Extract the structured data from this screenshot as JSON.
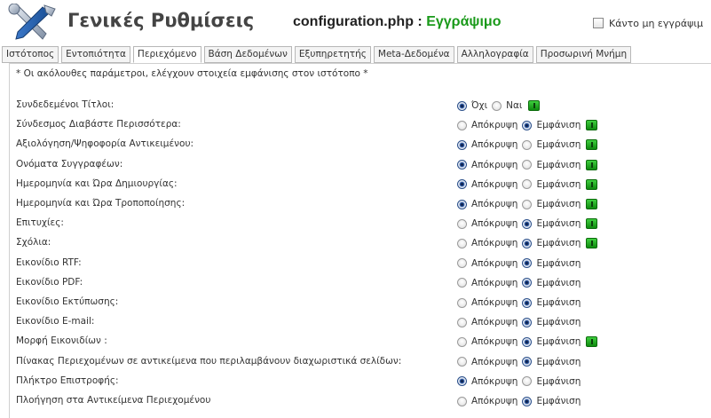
{
  "header": {
    "title": "Γενικές Ρυθμίσεις",
    "config_file": "configuration.php :",
    "config_status": "Εγγράψιμο",
    "make_unwritable": "Κάντο μη εγγράψιμ"
  },
  "tabs": [
    {
      "label": "Ιστότοπος"
    },
    {
      "label": "Εντοπιότητα"
    },
    {
      "label": "Περιεχόμενο",
      "active": true
    },
    {
      "label": "Βάση Δεδομένων"
    },
    {
      "label": "Εξυπηρετητής"
    },
    {
      "label": "Meta-Δεδομένα"
    },
    {
      "label": "Αλληλογραφία"
    },
    {
      "label": "Προσωρινή Μνήμη"
    }
  ],
  "note": "* Οι ακόλουθες παράμετροι, ελέγχουν στοιχεία εμφάνισης στον ιστότοπο *",
  "settings": [
    {
      "label": "Συνδεδεμένοι Τίτλοι:",
      "opt1": "Όχι",
      "opt2": "Ναι",
      "selected": 1,
      "help": true
    },
    {
      "label": "Σύνδεσμος Διαβάστε Περισσότερα:",
      "opt1": "Απόκρυψη",
      "opt2": "Εμφάνιση",
      "selected": 2,
      "help": true
    },
    {
      "label": "Αξιολόγηση/Ψηφοφορία Αντικειμένου:",
      "opt1": "Απόκρυψη",
      "opt2": "Εμφάνιση",
      "selected": 1,
      "help": true
    },
    {
      "label": "Ονόματα Συγγραφέων:",
      "opt1": "Απόκρυψη",
      "opt2": "Εμφάνιση",
      "selected": 1,
      "help": true
    },
    {
      "label": "Ημερομηνία και Ώρα Δημιουργίας:",
      "opt1": "Απόκρυψη",
      "opt2": "Εμφάνιση",
      "selected": 1,
      "help": true
    },
    {
      "label": "Ημερομηνία και Ώρα Τροποποίησης:",
      "opt1": "Απόκρυψη",
      "opt2": "Εμφάνιση",
      "selected": 1,
      "help": true
    },
    {
      "label": "Επιτυχίες:",
      "opt1": "Απόκρυψη",
      "opt2": "Εμφάνιση",
      "selected": 2,
      "help": true
    },
    {
      "label": "Σχόλια:",
      "opt1": "Απόκρυψη",
      "opt2": "Εμφάνιση",
      "selected": 2,
      "help": true
    },
    {
      "label": "Εικονίδιο RTF:",
      "opt1": "Απόκρυψη",
      "opt2": "Εμφάνιση",
      "selected": 2,
      "help": false
    },
    {
      "label": "Εικονίδιο PDF:",
      "opt1": "Απόκρυψη",
      "opt2": "Εμφάνιση",
      "selected": 2,
      "help": false
    },
    {
      "label": "Εικονίδιο Εκτύπωσης:",
      "opt1": "Απόκρυψη",
      "opt2": "Εμφάνιση",
      "selected": 2,
      "help": false
    },
    {
      "label": "Εικονίδιο E-mail:",
      "opt1": "Απόκρυψη",
      "opt2": "Εμφάνιση",
      "selected": 2,
      "help": false
    },
    {
      "label": "Μορφή Εικονιδίων :",
      "opt1": "Απόκρυψη",
      "opt2": "Εμφάνιση",
      "selected": 2,
      "help": true
    },
    {
      "label": "Πίνακας Περιεχομένων σε αντικείμενα που περιλαμβάνουν διαχωριστικά σελίδων:",
      "opt1": "Απόκρυψη",
      "opt2": "Εμφάνιση",
      "selected": 2,
      "help": false
    },
    {
      "label": "Πλήκτρο Επιστροφής:",
      "opt1": "Απόκρυψη",
      "opt2": "Εμφάνιση",
      "selected": 1,
      "help": false
    },
    {
      "label": "Πλοήγηση στα Αντικείμενα Περιεχομένου",
      "opt1": "Απόκρυψη",
      "opt2": "Εμφάνιση",
      "selected": 2,
      "help": false
    }
  ]
}
